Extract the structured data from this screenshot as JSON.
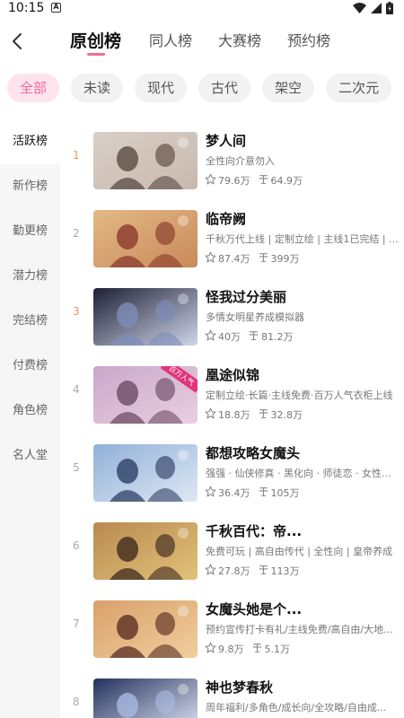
{
  "status": {
    "time": "10:15",
    "notif": "A"
  },
  "tabs": [
    {
      "label": "原创榜",
      "active": true
    },
    {
      "label": "同人榜",
      "active": false
    },
    {
      "label": "大赛榜",
      "active": false
    },
    {
      "label": "预约榜",
      "active": false
    }
  ],
  "chips": [
    {
      "label": "全部",
      "active": true
    },
    {
      "label": "未读",
      "active": false
    },
    {
      "label": "现代",
      "active": false
    },
    {
      "label": "古代",
      "active": false
    },
    {
      "label": "架空",
      "active": false
    },
    {
      "label": "二次元",
      "active": false
    }
  ],
  "sidebar": [
    {
      "label": "活跃榜",
      "active": true
    },
    {
      "label": "新作榜",
      "active": false
    },
    {
      "label": "勤更榜",
      "active": false
    },
    {
      "label": "潜力榜",
      "active": false
    },
    {
      "label": "完结榜",
      "active": false
    },
    {
      "label": "付费榜",
      "active": false
    },
    {
      "label": "角色榜",
      "active": false
    },
    {
      "label": "名人堂",
      "active": false
    }
  ],
  "rows": [
    {
      "rank": "1",
      "title": "梦人间",
      "desc": "全性向介意勿入",
      "stars": "79.6万",
      "words": "64.9万",
      "colors": [
        "#d9cfc6",
        "#5a4a44",
        "#c8b9ae"
      ],
      "hot": true
    },
    {
      "rank": "2",
      "title": "临帝阙",
      "desc": "千秋万代上线 | 定制立绘 | 主线1已完结 | ...",
      "stars": "87.4万",
      "words": "399万",
      "colors": [
        "#e3b886",
        "#8a3b2c",
        "#c98a5a"
      ],
      "hot": false
    },
    {
      "rank": "3",
      "title": "怪我过分美丽",
      "desc": "多情女明星养成模拟器",
      "stars": "40万",
      "words": "81.2万",
      "colors": [
        "#1d2036",
        "#7d8db8",
        "#cfd6e8"
      ],
      "hot": true
    },
    {
      "rank": "4",
      "title": "凰途似锦",
      "desc": "定制立绘·长篇·主线免费·百万人气衣柜上线",
      "stars": "18.8万",
      "words": "32.8万",
      "colors": [
        "#c9a7c9",
        "#6e4b66",
        "#e8d0e0"
      ],
      "badge": "百万人气",
      "hot": false
    },
    {
      "rank": "5",
      "title": "都想攻略女魔头",
      "desc": "强强 · 仙侠修真 · 黑化向 · 师徒恋 · 女性向 · ...",
      "stars": "36.4万",
      "words": "105万",
      "colors": [
        "#8fb0d8",
        "#2f3f66",
        "#dfe8f4"
      ],
      "hot": false
    },
    {
      "rank": "6",
      "title": "千秋百代：帝...",
      "desc": "免费可玩 | 高自由传代 | 全性向 | 皇帝养成",
      "stars": "27.8万",
      "words": "113万",
      "colors": [
        "#b98a4f",
        "#3e2a1e",
        "#e2c27a"
      ],
      "hot": false
    },
    {
      "rank": "7",
      "title": "女魔头她是个...",
      "desc": "预约宣传打卡有礼/主线免费/高自由/大地...",
      "stars": "9.8万",
      "words": "5.1万",
      "colors": [
        "#d9a06a",
        "#5a2f24",
        "#f0cf9e"
      ],
      "hot": false
    },
    {
      "rank": "8",
      "title": "神也梦春秋",
      "desc": "周年福利/多角色/成长向/全攻略/自由成...",
      "stars": "",
      "words": "",
      "colors": [
        "#24315e",
        "#a9b9e0",
        "#e6ecf8"
      ],
      "hot": false
    }
  ],
  "icons": {
    "star": "star-icon",
    "word": "word-count-icon",
    "back": "back-arrow-icon"
  },
  "accent": "#f06b9c"
}
